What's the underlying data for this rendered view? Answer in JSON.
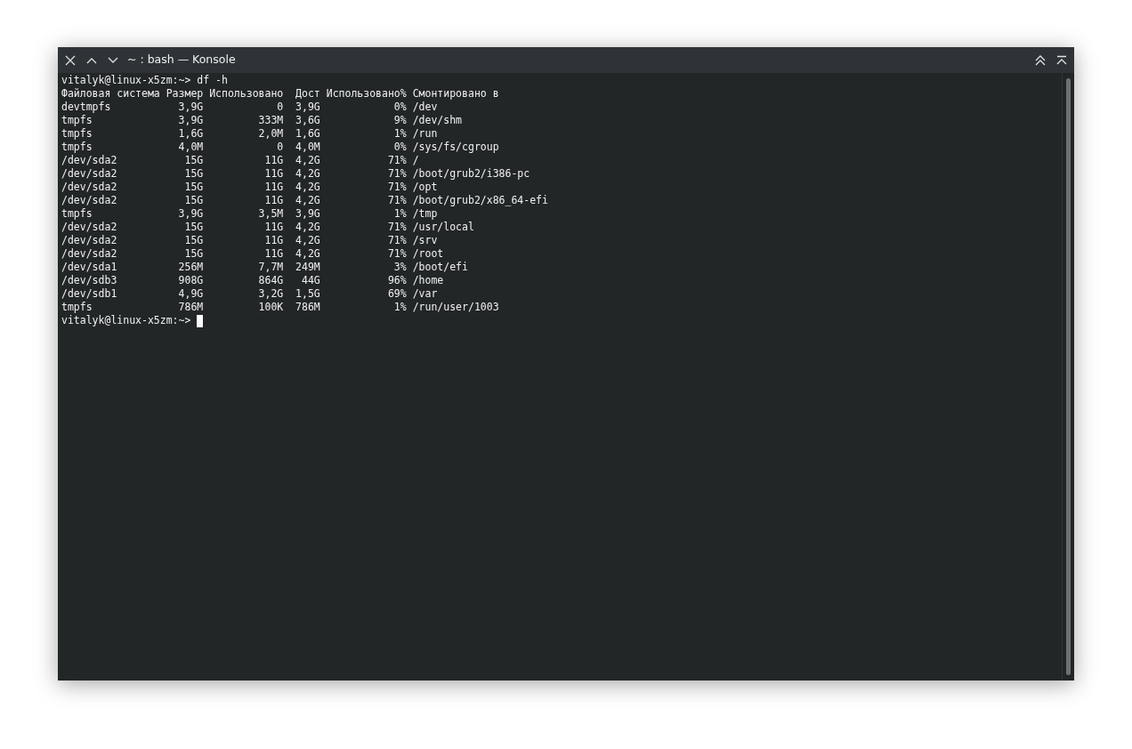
{
  "window": {
    "title": "~ : bash — Konsole"
  },
  "terminal": {
    "command_line": "vitalyk@linux-x5zm:~> df -h",
    "header": "Файловая система Размер Использовано  Дост Использовано% Смонтировано в",
    "rows": [
      {
        "filesystem": "devtmpfs",
        "size": "3,9G",
        "used": "0",
        "avail": "3,9G",
        "use_pct": "0%",
        "mount": "/dev"
      },
      {
        "filesystem": "tmpfs",
        "size": "3,9G",
        "used": "333M",
        "avail": "3,6G",
        "use_pct": "9%",
        "mount": "/dev/shm"
      },
      {
        "filesystem": "tmpfs",
        "size": "1,6G",
        "used": "2,0M",
        "avail": "1,6G",
        "use_pct": "1%",
        "mount": "/run"
      },
      {
        "filesystem": "tmpfs",
        "size": "4,0M",
        "used": "0",
        "avail": "4,0M",
        "use_pct": "0%",
        "mount": "/sys/fs/cgroup"
      },
      {
        "filesystem": "/dev/sda2",
        "size": "15G",
        "used": "11G",
        "avail": "4,2G",
        "use_pct": "71%",
        "mount": "/"
      },
      {
        "filesystem": "/dev/sda2",
        "size": "15G",
        "used": "11G",
        "avail": "4,2G",
        "use_pct": "71%",
        "mount": "/boot/grub2/i386-pc"
      },
      {
        "filesystem": "/dev/sda2",
        "size": "15G",
        "used": "11G",
        "avail": "4,2G",
        "use_pct": "71%",
        "mount": "/opt"
      },
      {
        "filesystem": "/dev/sda2",
        "size": "15G",
        "used": "11G",
        "avail": "4,2G",
        "use_pct": "71%",
        "mount": "/boot/grub2/x86_64-efi"
      },
      {
        "filesystem": "tmpfs",
        "size": "3,9G",
        "used": "3,5M",
        "avail": "3,9G",
        "use_pct": "1%",
        "mount": "/tmp"
      },
      {
        "filesystem": "/dev/sda2",
        "size": "15G",
        "used": "11G",
        "avail": "4,2G",
        "use_pct": "71%",
        "mount": "/usr/local"
      },
      {
        "filesystem": "/dev/sda2",
        "size": "15G",
        "used": "11G",
        "avail": "4,2G",
        "use_pct": "71%",
        "mount": "/srv"
      },
      {
        "filesystem": "/dev/sda2",
        "size": "15G",
        "used": "11G",
        "avail": "4,2G",
        "use_pct": "71%",
        "mount": "/root"
      },
      {
        "filesystem": "/dev/sda1",
        "size": "256M",
        "used": "7,7M",
        "avail": "249M",
        "use_pct": "3%",
        "mount": "/boot/efi"
      },
      {
        "filesystem": "/dev/sdb3",
        "size": "908G",
        "used": "864G",
        "avail": "44G",
        "use_pct": "96%",
        "mount": "/home"
      },
      {
        "filesystem": "/dev/sdb1",
        "size": "4,9G",
        "used": "3,2G",
        "avail": "1,5G",
        "use_pct": "69%",
        "mount": "/var"
      },
      {
        "filesystem": "tmpfs",
        "size": "786M",
        "used": "100K",
        "avail": "786M",
        "use_pct": "1%",
        "mount": "/run/user/1003"
      }
    ],
    "prompt": "vitalyk@linux-x5zm:~>"
  }
}
